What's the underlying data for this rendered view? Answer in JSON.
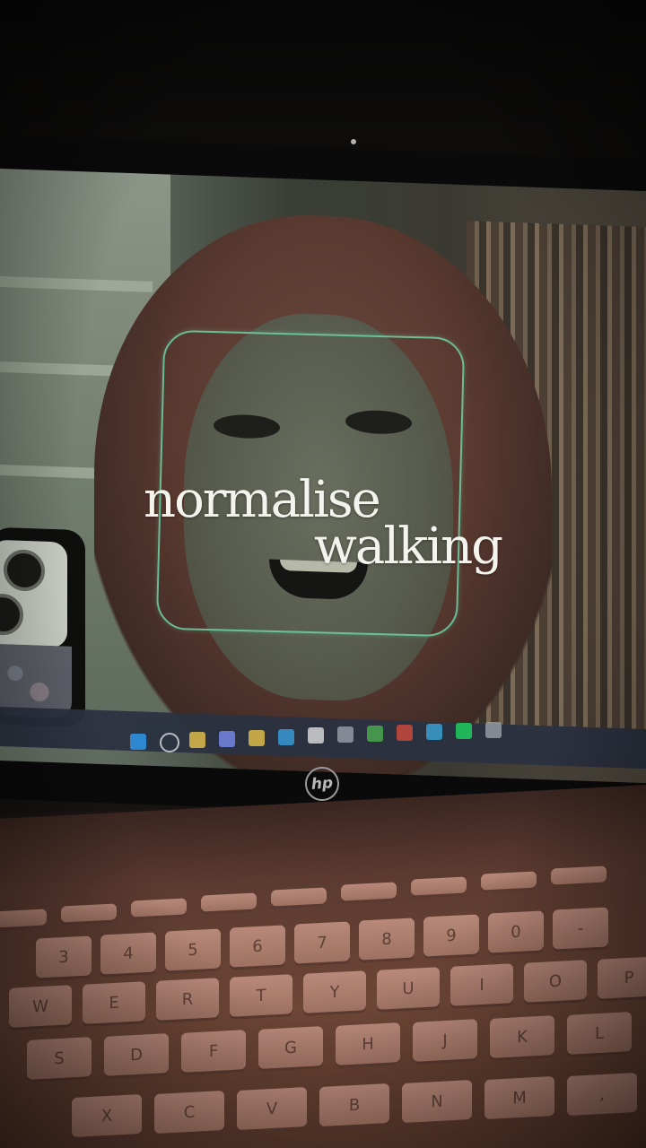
{
  "caption": {
    "line1": "normalise",
    "line2": "walking"
  },
  "accent_color": "#6fd4a8",
  "logo_text": "hp",
  "taskbar_icons": [
    "windows-start-icon",
    "search-icon",
    "file-explorer-icon",
    "chat-icon",
    "folder-icon",
    "edge-icon",
    "calendar-icon",
    "settings-icon",
    "chrome-icon",
    "app-icon",
    "store-icon",
    "spotify-icon",
    "camera-icon"
  ],
  "keyboard": {
    "row_num": [
      "3",
      "4",
      "5",
      "6",
      "7",
      "8",
      "9",
      "0",
      "-"
    ],
    "row_top": [
      "W",
      "E",
      "R",
      "T",
      "Y",
      "U",
      "I",
      "O",
      "P"
    ],
    "row_mid": [
      "S",
      "D",
      "F",
      "G",
      "H",
      "J",
      "K",
      "L"
    ],
    "row_bot": [
      "X",
      "C",
      "V",
      "B",
      "N",
      "M",
      ",",
      "."
    ]
  }
}
